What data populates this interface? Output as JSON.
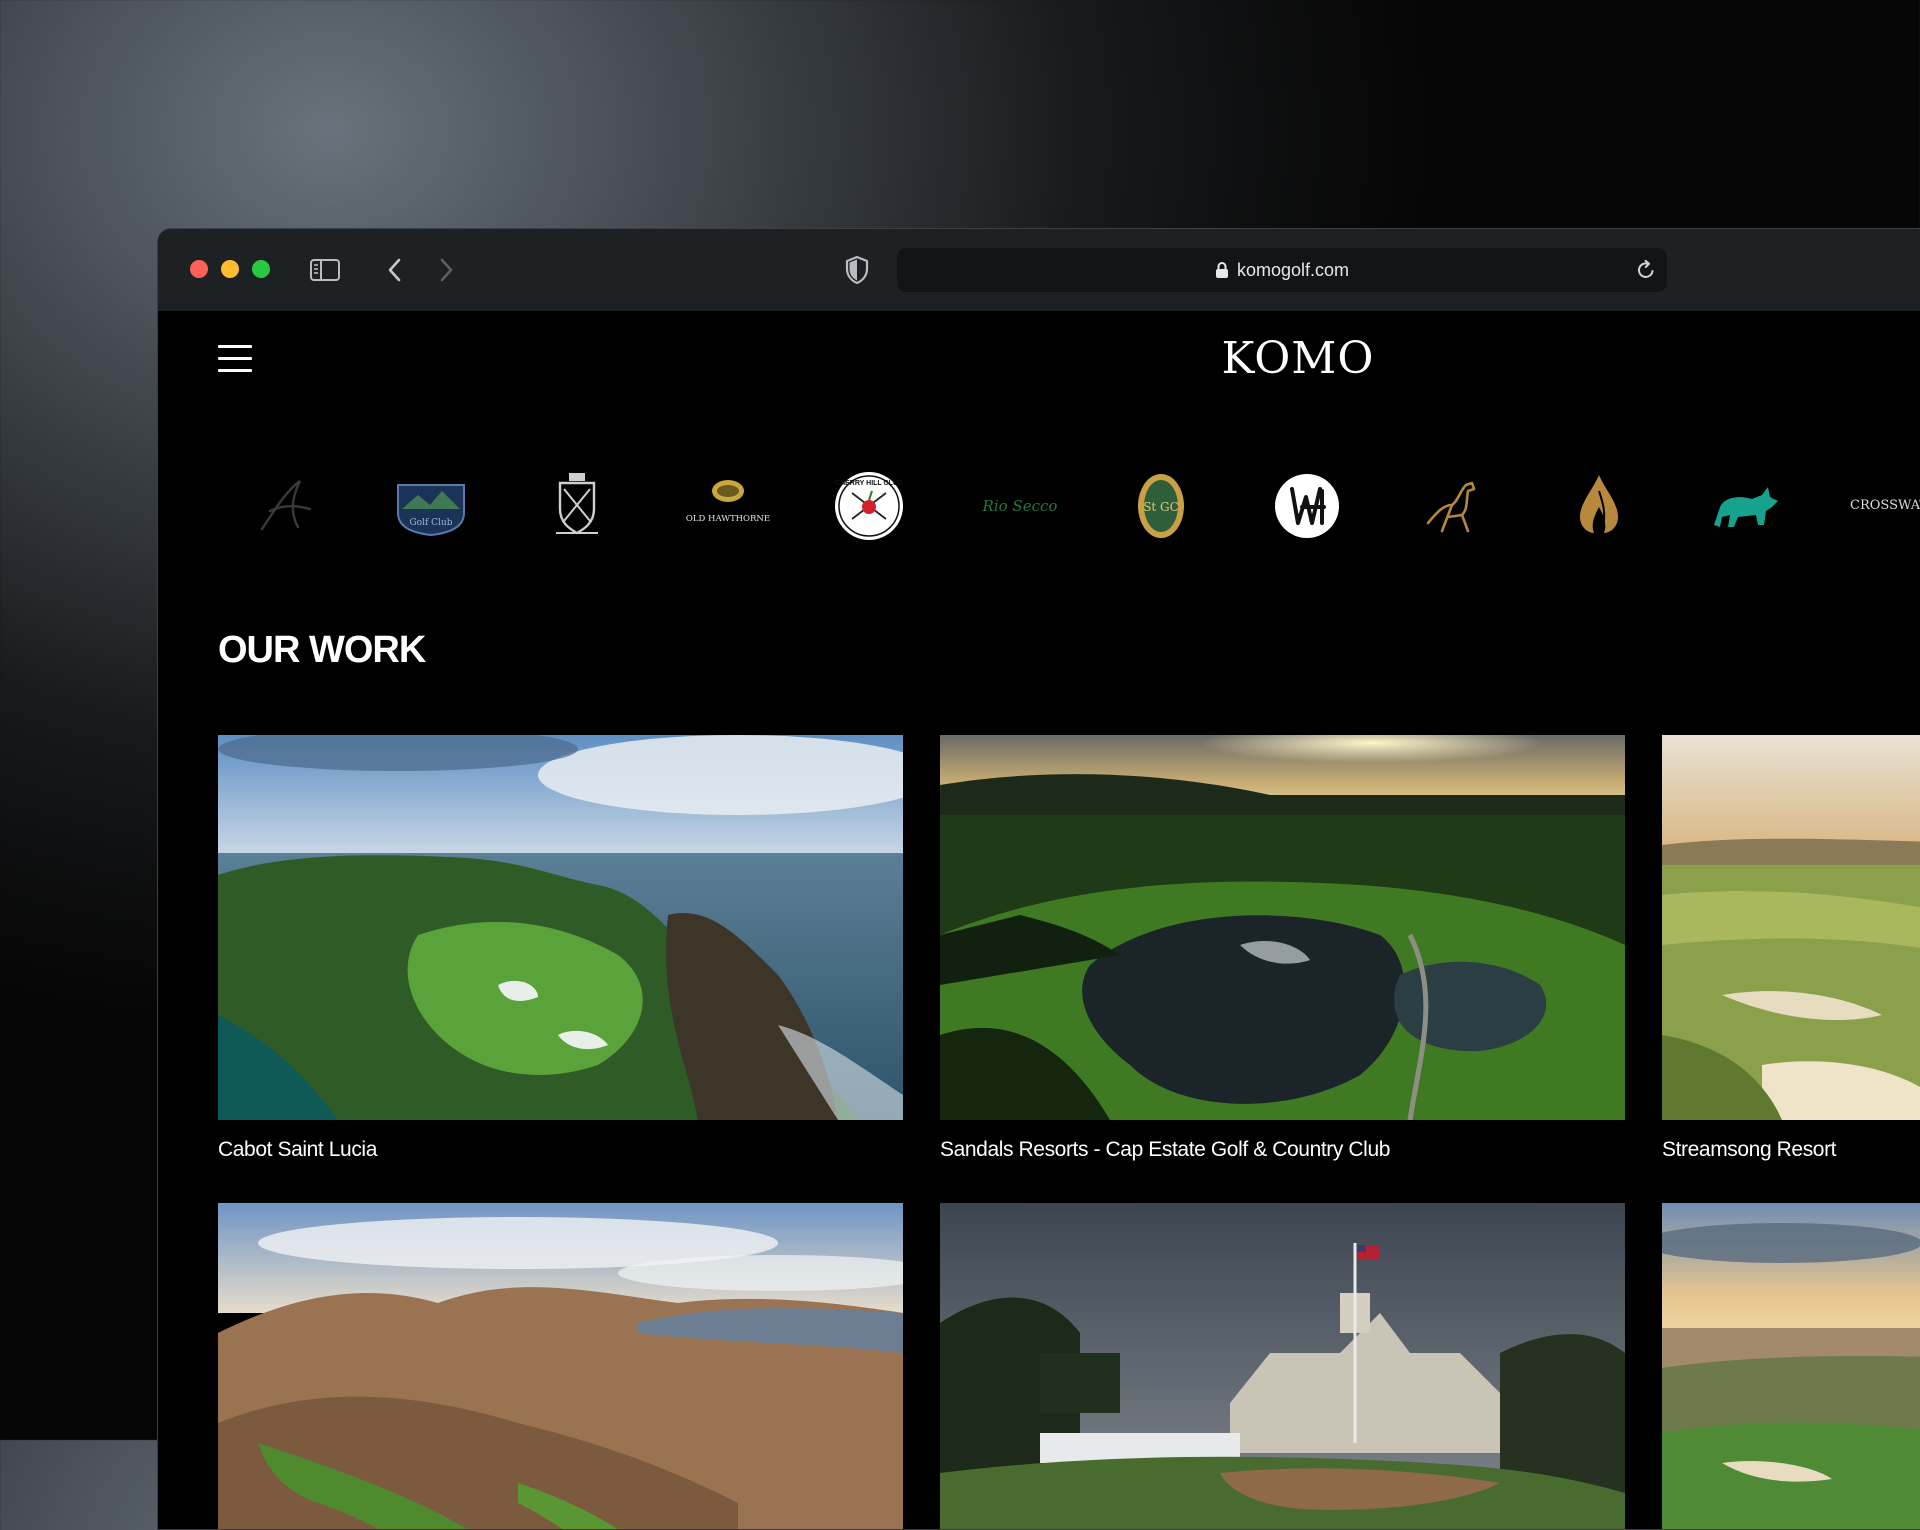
{
  "browser": {
    "url": "komogolf.com"
  },
  "site": {
    "logo_text": "KOMO",
    "section_title": "OUR WORK"
  },
  "client_logos": [
    {
      "name": "script-a-logo",
      "text": ""
    },
    {
      "name": "golf-club-badge-logo",
      "text": "Golf Club"
    },
    {
      "name": "crest-logo",
      "text": ""
    },
    {
      "name": "old-hawthorne-logo",
      "text": "OLD HAWTHORNE"
    },
    {
      "name": "cherry-hills-logo",
      "text": "CHERRY HILL CLUB"
    },
    {
      "name": "rio-secco-logo",
      "text": "Rio Secco"
    },
    {
      "name": "st-gf-logo",
      "text": "St GC"
    },
    {
      "name": "wh-monogram-logo",
      "text": ""
    },
    {
      "name": "horse-logo",
      "text": ""
    },
    {
      "name": "flame-logo",
      "text": ""
    },
    {
      "name": "bull-logo",
      "text": ""
    },
    {
      "name": "crosswater-logo",
      "text": "CROSSWATER GOLF"
    }
  ],
  "work": [
    {
      "title": "Cabot Saint Lucia"
    },
    {
      "title": "Sandals Resorts - Cap Estate Golf & Country Club"
    },
    {
      "title": "Streamsong Resort"
    },
    {
      "title": ""
    },
    {
      "title": ""
    },
    {
      "title": ""
    }
  ],
  "colors": {
    "page_bg": "#000000",
    "titlebar": "#1e2124",
    "urlbar": "#121416",
    "text": "#ffffff"
  }
}
